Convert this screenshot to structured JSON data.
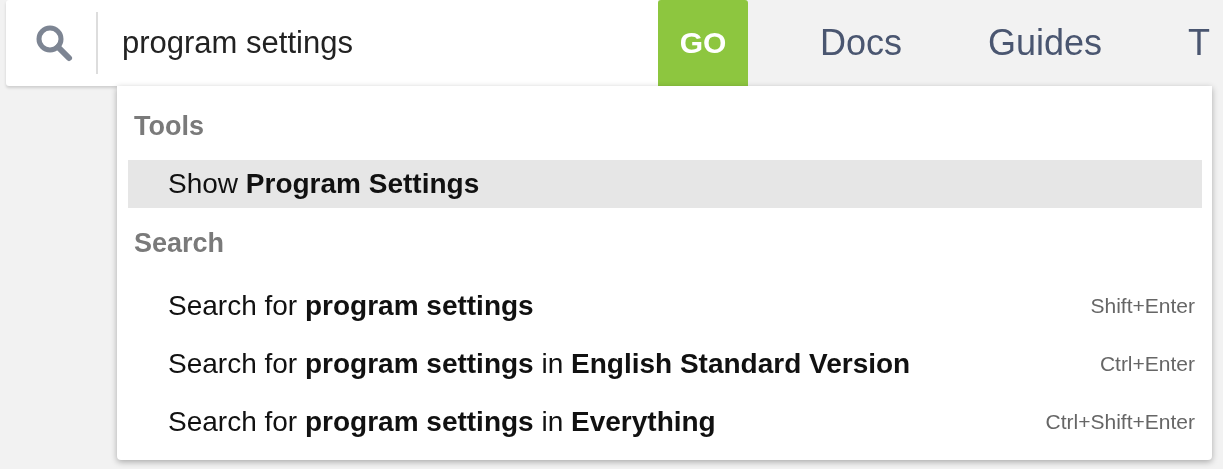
{
  "search": {
    "value": "program settings",
    "button": "GO"
  },
  "nav": [
    {
      "label": "Docs"
    },
    {
      "label": "Guides"
    },
    {
      "label": "T"
    }
  ],
  "dropdown": {
    "groups": [
      {
        "header": "Tools",
        "items": [
          {
            "text": "Show **Program Settings**",
            "selected": true
          }
        ]
      },
      {
        "header": "Search",
        "items": [
          {
            "text": "Search for **program settings**",
            "shortcut": "Shift+Enter",
            "selected": false
          },
          {
            "text": "Search for **program settings** in **English Standard Version**",
            "shortcut": "Ctrl+Enter",
            "selected": false
          },
          {
            "text": "Search for **program settings** in **Everything**",
            "shortcut": "Ctrl+Shift+Enter",
            "selected": false
          }
        ]
      }
    ]
  }
}
